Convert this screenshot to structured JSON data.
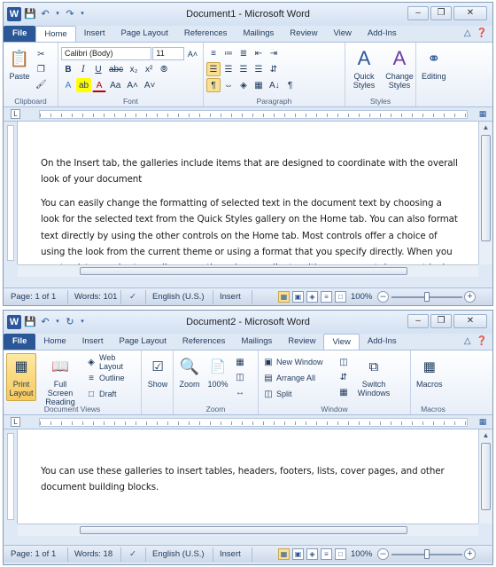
{
  "window1": {
    "title": "Document1 - Microsoft Word",
    "tabs": [
      "File",
      "Home",
      "Insert",
      "Page Layout",
      "References",
      "Mailings",
      "Review",
      "View",
      "Add-Ins"
    ],
    "ribbon": {
      "clipboard": {
        "label": "Clipboard",
        "paste": "Paste"
      },
      "font": {
        "label": "Font",
        "font_name": "Calibri (Body)",
        "font_size": "11"
      },
      "paragraph": {
        "label": "Paragraph"
      },
      "styles": {
        "label": "Styles",
        "quick_styles": "Quick Styles",
        "change_styles": "Change Styles"
      },
      "editing": {
        "label": "Editing"
      }
    },
    "paragraphs": [
      "On the Insert tab, the galleries include items that are designed to coordinate with the overall look of your document",
      "You can easily change the formatting of selected text in the document text by choosing a look for the selected text from the Quick Styles gallery on the Home tab. You can also format text directly by using the other controls on the Home tab. Most controls offer a choice of using the look from the current theme or using a format that you specify directly. When you create pictures, charts, or diagrams, they also coordinate with your current document look."
    ],
    "status": {
      "page": "Page: 1 of 1",
      "words": "Words: 101",
      "language": "English (U.S.)",
      "mode": "Insert",
      "zoom": "100%"
    }
  },
  "window2": {
    "title": "Document2 - Microsoft Word",
    "tabs": [
      "File",
      "Home",
      "Insert",
      "Page Layout",
      "References",
      "Mailings",
      "Review",
      "View",
      "Add-Ins"
    ],
    "ribbon": {
      "document_views": {
        "label": "Document Views",
        "print_layout": "Print Layout",
        "full_screen_reading": "Full Screen Reading",
        "web_layout": "Web Layout",
        "outline": "Outline",
        "draft": "Draft"
      },
      "show": {
        "label": "Show"
      },
      "zoom": {
        "label": "Zoom",
        "zoom": "Zoom",
        "hundred": "100%"
      },
      "window": {
        "label": "Window",
        "new_window": "New Window",
        "arrange_all": "Arrange All",
        "split": "Split",
        "switch_windows": "Switch Windows"
      },
      "macros": {
        "label": "Macros",
        "macros": "Macros"
      }
    },
    "paragraphs": [
      "You can use these galleries to insert tables, headers, footers, lists, cover pages, and other document building blocks."
    ],
    "status": {
      "page": "Page: 1 of 1",
      "words": "Words: 18",
      "language": "English (U.S.)",
      "mode": "Insert",
      "zoom": "100%"
    }
  },
  "colors": {
    "file_tab": "#2b5797",
    "frame": "#dfe9f5",
    "highlight": "#fbe092"
  }
}
